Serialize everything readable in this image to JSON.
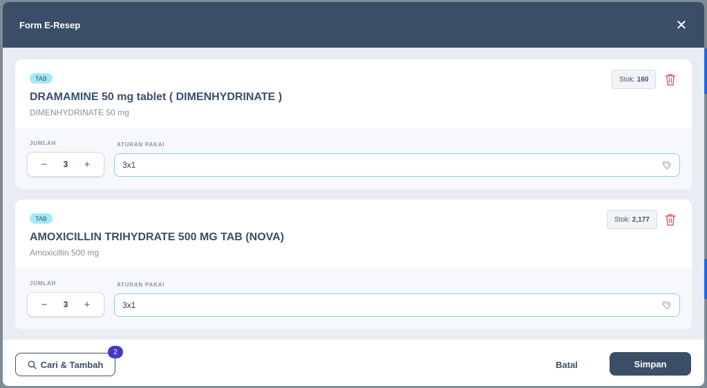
{
  "modal": {
    "title": "Form E-Resep",
    "close_icon": "close-icon"
  },
  "items": [
    {
      "badge": "TAB",
      "name": "DRAMAMINE 50 mg tablet ( DIMENHYDRINATE )",
      "generic": "DIMENHYDRINATE 50 mg",
      "stock_label": "Stok:",
      "stock_value": "160",
      "jumlah_label": "JUMLAH",
      "quantity": "3",
      "aturan_label": "ATURAN PAKAI",
      "aturan_value": "3x1"
    },
    {
      "badge": "TAB",
      "name": "AMOXICILLIN TRIHYDRATE 500 MG TAB (NOVA)",
      "generic": "Amoxicillin 500 mg",
      "stock_label": "Stok:",
      "stock_value": "2,177",
      "jumlah_label": "JUMLAH",
      "quantity": "3",
      "aturan_label": "ATURAN PAKAI",
      "aturan_value": "3x1"
    }
  ],
  "stepper": {
    "minus": "−",
    "plus": "+"
  },
  "footer": {
    "search_label": "Cari & Tambah",
    "search_count": "2",
    "cancel_label": "Batal",
    "save_label": "Simpan"
  },
  "colors": {
    "header": "#3b4e68",
    "badge": "#a5e8f7",
    "count_badge": "#4338ca",
    "trash": "#e05a5a"
  }
}
